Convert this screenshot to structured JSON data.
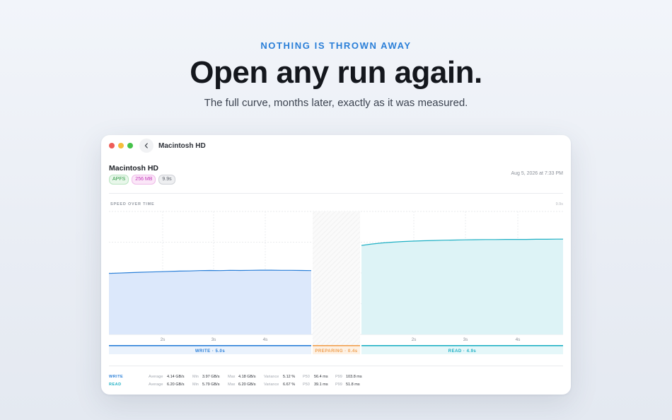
{
  "hero": {
    "eyebrow": "NOTHING IS THROWN AWAY",
    "headline": "Open any run again.",
    "subhead": "The full curve, months later, exactly as it was measured."
  },
  "window": {
    "title": "Macintosh HD",
    "back_icon": "chevron-left-icon"
  },
  "run": {
    "title": "Macintosh HD",
    "badges": {
      "filesystem": "APFS",
      "size": "256 MB",
      "duration": "9.9s"
    },
    "date": "Aug 5, 2026 at 7:33 PM"
  },
  "colors": {
    "accent": "#2a7fd8",
    "write": "#2a7fd8",
    "read": "#1fb0c4",
    "preparing": "#f0a050"
  },
  "chart": {
    "label": "SPEED OVER TIME",
    "duration": "9.9s"
  },
  "chart_data": {
    "type": "area",
    "title": "SPEED OVER TIME",
    "duration_s": 9.9,
    "ylim": [
      0,
      8
    ],
    "grid": true,
    "phases": [
      {
        "name": "WRITE",
        "label": "WRITE · 5.0s",
        "start_s": 0,
        "end_s": 5.0
      },
      {
        "name": "PREPARING",
        "label": "PREPARING · 0.4s",
        "start_s": 5.0,
        "end_s": 5.4
      },
      {
        "name": "READ",
        "label": "READ · 4.9s",
        "start_s": 5.4,
        "end_s": 10.3
      }
    ],
    "x_ticks": {
      "write": [
        "2s",
        "3s",
        "4s"
      ],
      "read": [
        "2s",
        "3s",
        "4s"
      ]
    },
    "series": [
      {
        "name": "WRITE",
        "x": [
          0,
          0.25,
          0.5,
          0.75,
          1.0,
          1.25,
          1.5,
          1.75,
          2.0,
          2.25,
          2.5,
          2.75,
          3.0,
          3.25,
          3.5,
          3.75,
          4.0,
          4.25,
          4.5,
          4.75,
          5.0
        ],
        "values": [
          3.97,
          3.99,
          4.02,
          4.04,
          4.06,
          4.08,
          4.1,
          4.12,
          4.13,
          4.15,
          4.16,
          4.15,
          4.17,
          4.16,
          4.17,
          4.18,
          4.18,
          4.17,
          4.17,
          4.16,
          4.15
        ]
      },
      {
        "name": "READ",
        "x": [
          0,
          0.25,
          0.5,
          0.75,
          1.0,
          1.25,
          1.5,
          1.75,
          2.0,
          2.25,
          2.5,
          2.75,
          3.0,
          3.25,
          3.5,
          3.75,
          4.0,
          4.25,
          4.5,
          4.75,
          4.9
        ],
        "values": [
          5.79,
          5.88,
          5.95,
          6.0,
          6.04,
          6.07,
          6.09,
          6.11,
          6.13,
          6.14,
          6.15,
          6.16,
          6.17,
          6.17,
          6.18,
          6.18,
          6.18,
          6.19,
          6.19,
          6.2,
          6.2
        ]
      }
    ]
  },
  "stats": [
    {
      "series": "WRITE",
      "average_label": "Average",
      "average": "4.14 GB/s",
      "min_label": "Min",
      "min": "3.97 GB/s",
      "max_label": "Max",
      "max": "4.18 GB/s",
      "variance_label": "Variance",
      "variance": "5.12 %",
      "p50_label": "P50",
      "p50": "56.4 ms",
      "p99_label": "P99",
      "p99": "103.8 ms"
    },
    {
      "series": "READ",
      "average_label": "Average",
      "average": "6.20 GB/s",
      "min_label": "Min",
      "min": "5.79 GB/s",
      "max_label": "Max",
      "max": "6.20 GB/s",
      "variance_label": "Variance",
      "variance": "6.67 %",
      "p50_label": "P50",
      "p50": "39.1 ms",
      "p99_label": "P99",
      "p99": "51.8 ms"
    }
  ]
}
